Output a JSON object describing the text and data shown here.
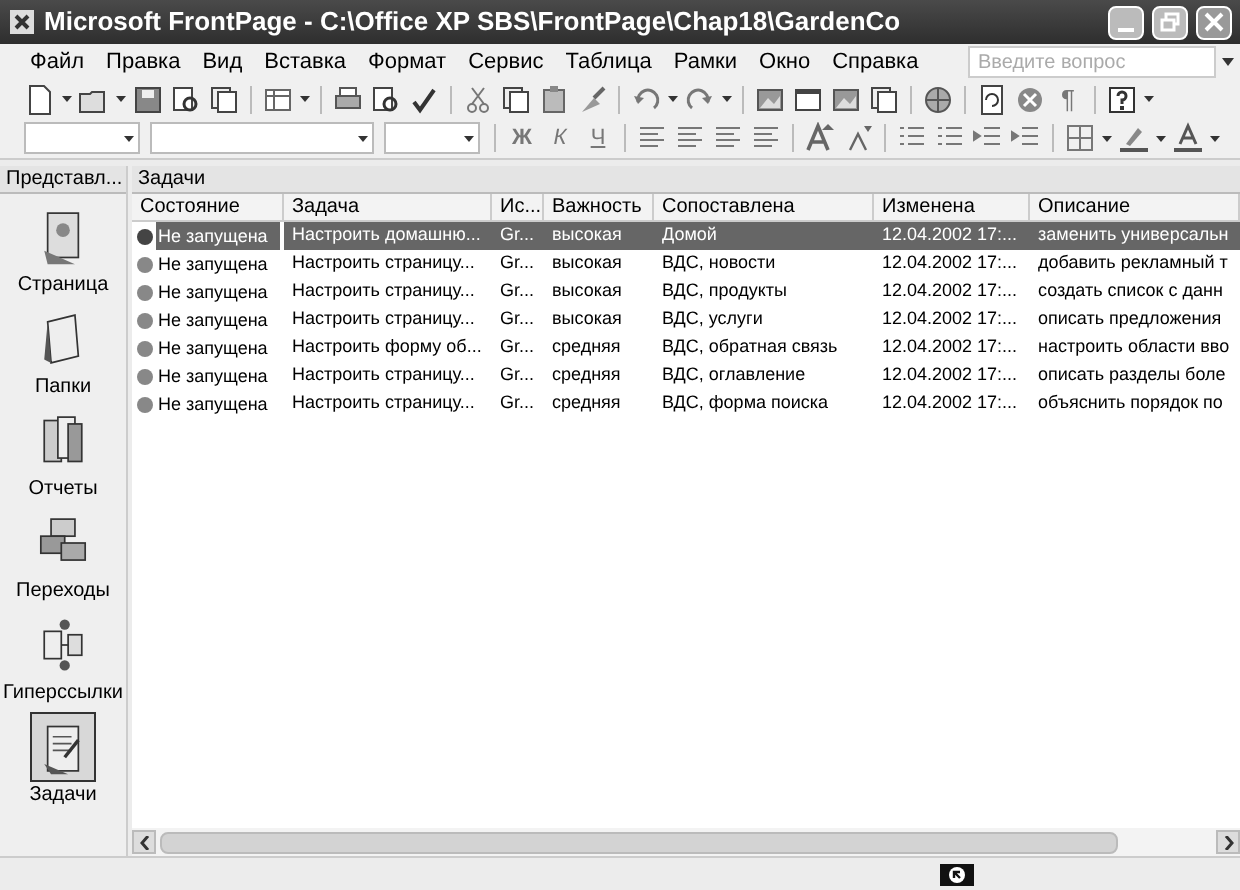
{
  "window": {
    "title": "Microsoft FrontPage - C:\\Office XP SBS\\FrontPage\\Chap18\\GardenCo"
  },
  "menu": [
    "Файл",
    "Правка",
    "Вид",
    "Вставка",
    "Формат",
    "Сервис",
    "Таблица",
    "Рамки",
    "Окно",
    "Справка"
  ],
  "help_search": {
    "placeholder": "Введите вопрос"
  },
  "format_toolbar": {
    "bold": "Ж",
    "italic": "К",
    "underline": "Ч"
  },
  "standard_toolbar": {
    "pilcrow": "¶"
  },
  "views_bar": {
    "title": "Представл...",
    "items": [
      {
        "label": "Страница",
        "selected": false
      },
      {
        "label": "Папки",
        "selected": false
      },
      {
        "label": "Отчеты",
        "selected": false
      },
      {
        "label": "Переходы",
        "selected": false
      },
      {
        "label": "Гиперссылки",
        "selected": false
      },
      {
        "label": "Задачи",
        "selected": true
      }
    ]
  },
  "tasks": {
    "title": "Задачи",
    "columns": [
      "Состояние",
      "Задача",
      "Ис...",
      "Важность",
      "Сопоставлена",
      "Изменена",
      "Описание"
    ],
    "rows": [
      {
        "selected": true,
        "cells": [
          "Не запущена",
          "Настроить домашню...",
          "Gr...",
          "высокая",
          "Домой",
          "12.04.2002 17:...",
          "заменить универсальн"
        ]
      },
      {
        "selected": false,
        "cells": [
          "Не запущена",
          "Настроить страницу...",
          "Gr...",
          "высокая",
          "ВДС, новости",
          "12.04.2002 17:...",
          "добавить рекламный т"
        ]
      },
      {
        "selected": false,
        "cells": [
          "Не запущена",
          "Настроить страницу...",
          "Gr...",
          "высокая",
          "ВДС, продукты",
          "12.04.2002 17:...",
          "создать список с данн"
        ]
      },
      {
        "selected": false,
        "cells": [
          "Не запущена",
          "Настроить страницу...",
          "Gr...",
          "высокая",
          "ВДС, услуги",
          "12.04.2002 17:...",
          "описать предложения"
        ]
      },
      {
        "selected": false,
        "cells": [
          "Не запущена",
          "Настроить форму об...",
          "Gr...",
          "средняя",
          "ВДС, обратная связь",
          "12.04.2002 17:...",
          "настроить области вво"
        ]
      },
      {
        "selected": false,
        "cells": [
          "Не запущена",
          "Настроить страницу...",
          "Gr...",
          "средняя",
          "ВДС, оглавление",
          "12.04.2002 17:...",
          "описать разделы боле"
        ]
      },
      {
        "selected": false,
        "cells": [
          "Не запущена",
          "Настроить страницу...",
          "Gr...",
          "средняя",
          "ВДС, форма поиска",
          "12.04.2002 17:...",
          "объяснить порядок по"
        ]
      }
    ]
  }
}
